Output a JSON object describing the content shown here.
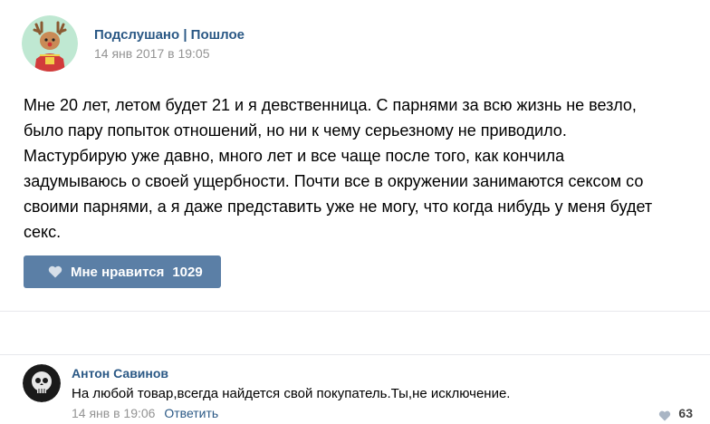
{
  "post": {
    "author": "Подслушано | Пошлое",
    "date": "14 янв 2017 в 19:05",
    "text_lines": [
      "Мне 20 лет, летом будет 21 и я девственница. С парнями за всю жизнь не везло,",
      "было пару попыток отношений, но ни к чему серьезному не приводило.",
      "Мастурбирую уже давно, много лет и все чаще после того, как кончила",
      "задумываюсь о своей ущербности. Почти все в окружении занимаются сексом со",
      "своими парнями, а я даже представить уже не могу, что когда нибудь у меня будет",
      "секс."
    ],
    "like_label": "Мне нравится",
    "like_count": "1029",
    "like_icon": "heart-icon"
  },
  "comment": {
    "author": "Антон Савинов",
    "text": "На любой товар,всегда найдется свой покупатель.Ты,не исключение.",
    "date": "14 янв в 19:06",
    "reply_label": "Ответить",
    "like_count": "63",
    "like_icon": "heart-icon"
  },
  "colors": {
    "link": "#2a5885",
    "like_button": "#5b7fa6",
    "muted": "#939393",
    "avatar_bg": "#b5e6cc"
  }
}
